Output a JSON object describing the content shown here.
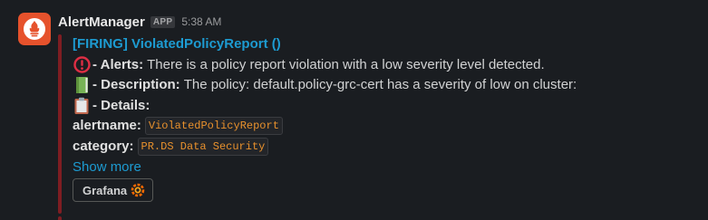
{
  "message": {
    "sender": "AlertManager",
    "badge": "APP",
    "time": "5:38 AM",
    "accent_color": "#7f1d22",
    "avatar_icon": "prometheus-logo-icon"
  },
  "attachment": {
    "title": "[FIRING] ViolatedPolicyReport ()",
    "alerts": {
      "icon": "exclamation-circle-icon",
      "label": " - Alerts:",
      "text": "There is a policy report violation with a low severity level detected."
    },
    "description": {
      "icon": "green-book-icon",
      "label": " - Description:",
      "text": "The policy: default.policy-grc-cert has a severity of low on cluster:"
    },
    "details": {
      "icon": "clipboard-icon",
      "label": " - Details:"
    },
    "fields": [
      {
        "key": "alertname:",
        "value": "ViolatedPolicyReport"
      },
      {
        "key": "category:",
        "value": "PR.DS Data Security"
      }
    ],
    "show_more": "Show more",
    "button": {
      "label": "Grafana",
      "icon": "grafana-logo-icon"
    }
  }
}
